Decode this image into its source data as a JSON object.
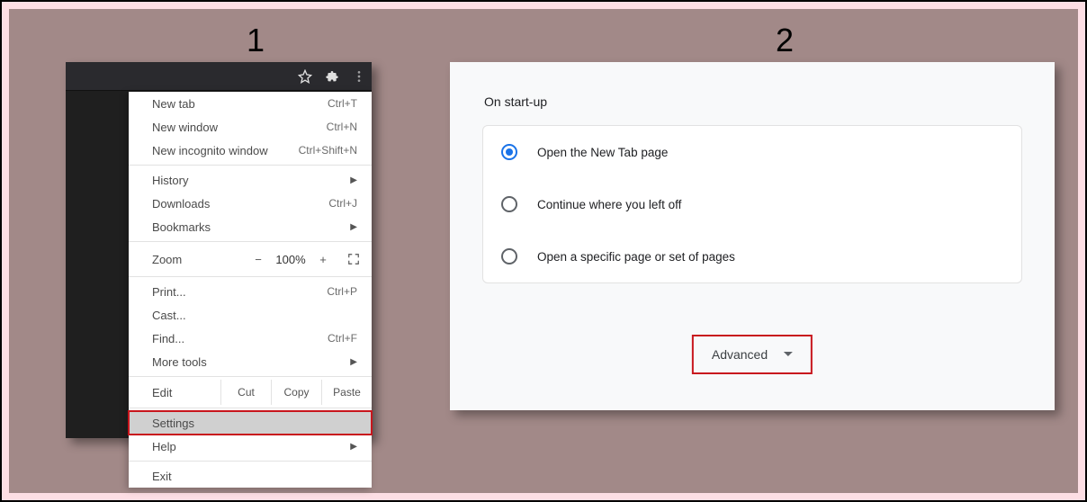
{
  "steps": {
    "one": "1",
    "two": "2"
  },
  "menu": {
    "newTab": {
      "label": "New tab",
      "shortcut": "Ctrl+T"
    },
    "newWindow": {
      "label": "New window",
      "shortcut": "Ctrl+N"
    },
    "newIncognito": {
      "label": "New incognito window",
      "shortcut": "Ctrl+Shift+N"
    },
    "history": {
      "label": "History"
    },
    "downloads": {
      "label": "Downloads",
      "shortcut": "Ctrl+J"
    },
    "bookmarks": {
      "label": "Bookmarks"
    },
    "zoom": {
      "label": "Zoom",
      "minus": "−",
      "value": "100%",
      "plus": "+"
    },
    "print": {
      "label": "Print...",
      "shortcut": "Ctrl+P"
    },
    "cast": {
      "label": "Cast..."
    },
    "find": {
      "label": "Find...",
      "shortcut": "Ctrl+F"
    },
    "moreTools": {
      "label": "More tools"
    },
    "edit": {
      "label": "Edit",
      "cut": "Cut",
      "copy": "Copy",
      "paste": "Paste"
    },
    "settings": {
      "label": "Settings"
    },
    "help": {
      "label": "Help"
    },
    "exit": {
      "label": "Exit"
    }
  },
  "settingsPanel": {
    "title": "On start-up",
    "options": {
      "newTab": "Open the New Tab page",
      "continue": "Continue where you left off",
      "specific": "Open a specific page or set of pages"
    },
    "advanced": "Advanced"
  }
}
